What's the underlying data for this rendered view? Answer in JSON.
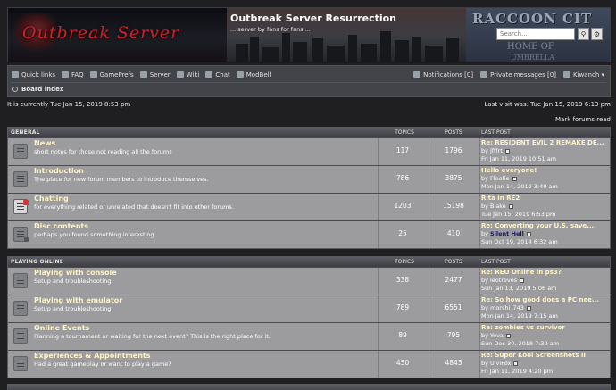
{
  "header": {
    "logo_text": "Outbreak Server",
    "site_title": "Outbreak Server Resurrection",
    "site_description": "... server by fans for fans ...",
    "banner_sign": "RACCOON CIT",
    "banner_home": "HOME OF",
    "banner_uni": "UMBRELLA",
    "search_placeholder": "Search...",
    "search_icon": "search-icon",
    "advanced_icon": "gear-icon"
  },
  "navbar": {
    "left": [
      {
        "label": "Quick links",
        "icon": "menu-icon"
      },
      {
        "label": "FAQ",
        "icon": "question-icon"
      },
      {
        "label": "GamePrefs",
        "icon": "wrench-icon"
      },
      {
        "label": "Server",
        "icon": "server-icon"
      },
      {
        "label": "Wiki",
        "icon": "book-icon"
      },
      {
        "label": "Chat",
        "icon": "chat-icon"
      },
      {
        "label": "ModBell",
        "icon": "bell-icon"
      }
    ],
    "notifications": "Notifications [0]",
    "private_messages": "Private messages [0]",
    "user": "Kiwanch ▾",
    "breadcrumb": "Board index"
  },
  "status": {
    "current_time": "It is currently Tue Jan 15, 2019 8:53 pm",
    "last_visit": "Last visit was: Tue Jan 15, 2019 6:13 pm",
    "mark_read": "Mark forums read"
  },
  "categories": [
    {
      "name": "GENERAL",
      "col_topics": "TOPICS",
      "col_posts": "POSTS",
      "col_last": "LAST POST",
      "forums": [
        {
          "title": "News",
          "desc": "short notes for those not reading all the forums",
          "topics": "117",
          "posts": "1796",
          "last_title": "Re: RESIDENT EVIL 2 REMAKE DE...",
          "last_by": "by",
          "last_author": "jfffrt",
          "last_time": "Fri Jan 11, 2019 10:51 am",
          "icon": "read"
        },
        {
          "title": "Introduction",
          "desc": "The place for new forum members to introduce themselves.",
          "topics": "786",
          "posts": "3875",
          "last_title": "Hello everyone!",
          "last_by": "by",
          "last_author": "Floofie",
          "last_time": "Mon Jan 14, 2019 3:40 am",
          "icon": "read"
        },
        {
          "title": "Chatting",
          "desc": "for everything related or unrelated that doesn't fit into other forums.",
          "topics": "1203",
          "posts": "15198",
          "last_title": "Rita in RE2",
          "last_by": "by",
          "last_author": "Blake",
          "last_time": "Tue Jan 15, 2019 6:53 pm",
          "icon": "unread"
        },
        {
          "title": "Disc contents",
          "desc": "perhaps you found something interesting",
          "topics": "25",
          "posts": "410",
          "last_title": "Re: Converting your U.S. save...",
          "last_by": "by",
          "last_author": "Silent Hell",
          "last_time": "Sun Oct 19, 2014 6:32 am",
          "icon": "locked",
          "author_mod": true
        }
      ]
    },
    {
      "name": "PLAYING ONLINE",
      "col_topics": "TOPICS",
      "col_posts": "POSTS",
      "col_last": "LAST POST",
      "forums": [
        {
          "title": "Playing with console",
          "desc": "Setup and troubleshooting",
          "topics": "338",
          "posts": "2477",
          "last_title": "Re: REO Online in ps3?",
          "last_by": "by",
          "last_author": "leotreves",
          "last_time": "Sun Jan 13, 2019 5:06 am",
          "icon": "read"
        },
        {
          "title": "Playing with emulator",
          "desc": "Setup and troubleshooting",
          "topics": "789",
          "posts": "6551",
          "last_title": "Re: So how good does a PC nee...",
          "last_by": "by",
          "last_author": "morshi_743",
          "last_time": "Mon Jan 14, 2019 7:15 am",
          "icon": "read"
        },
        {
          "title": "Online Events",
          "desc": "Planning a tournament or waiting for the next event? This is the right place for it.",
          "topics": "89",
          "posts": "795",
          "last_title": "Re: zombies vs survivor",
          "last_by": "by",
          "last_author": "Yova",
          "last_time": "Sun Dec 30, 2018 7:39 am",
          "icon": "read"
        },
        {
          "title": "Experiences & Appointments",
          "desc": "Had a great gameplay or want to play a game?",
          "topics": "450",
          "posts": "4843",
          "last_title": "Re: Super Kool Screenshots II",
          "last_by": "by",
          "last_author": "UlviFox",
          "last_time": "Fri Jan 11, 2019 4:20 pm",
          "icon": "read"
        }
      ]
    }
  ]
}
